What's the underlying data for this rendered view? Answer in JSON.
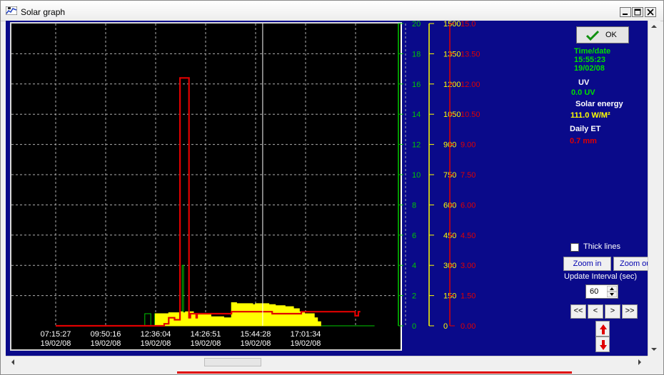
{
  "window": {
    "title": "Solar graph"
  },
  "buttons": {
    "ok": "OK",
    "zoom_in": "Zoom in",
    "zoom_out": "Zoom out"
  },
  "info": {
    "time_label": "Time/date",
    "time": "15:55:23",
    "date": "19/02/08",
    "uv_label": "UV",
    "uv_value": "0.0 UV",
    "solar_label": "Solar energy",
    "solar_value": "111.0 W/M²",
    "et_label": "Daily ET",
    "et_value": "0.7 mm"
  },
  "controls": {
    "thick_lines": "Thick lines",
    "thick_lines_checked": false,
    "update_interval_label": "Update Interval (sec)",
    "update_interval_value": "60",
    "nav_first": "<<",
    "nav_prev": "<",
    "nav_next": ">",
    "nav_last": ">>"
  },
  "colors": {
    "uv": "#00c800",
    "solar": "#ffff00",
    "et": "#e00000",
    "background": "#0a0a8a",
    "plot_bg": "#000000"
  },
  "chart_data": {
    "type": "line",
    "x_ticks": [
      {
        "time": "07:15:27",
        "date": "19/02/08"
      },
      {
        "time": "09:50:16",
        "date": "19/02/08"
      },
      {
        "time": "12:36:04",
        "date": "19/02/08"
      },
      {
        "time": "14:26:51",
        "date": "19/02/08"
      },
      {
        "time": "15:44:28",
        "date": "19/02/08"
      },
      {
        "time": "17:01:34",
        "date": "19/02/08"
      }
    ],
    "cursor_time": "15:55:23",
    "uv_axis": {
      "ylim": [
        0,
        20
      ],
      "ticks": [
        "0",
        "2",
        "4",
        "6",
        "8",
        "10",
        "12",
        "14",
        "16",
        "18",
        "20"
      ]
    },
    "solar_axis": {
      "ylim": [
        0,
        1500
      ],
      "ticks": [
        "0",
        "150",
        "300",
        "450",
        "600",
        "750",
        "900",
        "1050",
        "1200",
        "1350",
        "1500"
      ]
    },
    "et_axis": {
      "ylim": [
        0,
        15
      ],
      "ticks": [
        "0.00",
        "1.50",
        "3.00",
        "4.50",
        "6.00",
        "7.50",
        "9.00",
        "10.50",
        "12.00",
        "13.50",
        "15.0"
      ]
    },
    "grid": true,
    "series": [
      {
        "key": "uv",
        "points": [
          [
            "07:15:27",
            0
          ],
          [
            "12:00:00",
            0
          ],
          [
            "12:00:00",
            0.8
          ],
          [
            "12:20:00",
            0.8
          ],
          [
            "12:20:00",
            0
          ],
          [
            "12:33:00",
            0
          ],
          [
            "12:33:00",
            0.8
          ],
          [
            "12:55:00",
            0.8
          ],
          [
            "12:55:00",
            0
          ],
          [
            "13:05:00",
            0
          ],
          [
            "13:05:00",
            0.8
          ],
          [
            "13:35:00",
            0.8
          ],
          [
            "13:35:00",
            4.0
          ],
          [
            "13:38:00",
            4.0
          ],
          [
            "13:38:00",
            0
          ],
          [
            "14:25:00",
            0
          ],
          [
            "14:25:00",
            0.3
          ],
          [
            "17:20:00",
            0.3
          ],
          [
            "17:20:00",
            0
          ],
          [
            "18:48:00",
            0
          ]
        ]
      },
      {
        "key": "solar",
        "points": [
          [
            "12:35:00",
            0
          ],
          [
            "12:35:00",
            60
          ],
          [
            "13:05:00",
            60
          ],
          [
            "13:05:00",
            65
          ],
          [
            "13:30:00",
            65
          ],
          [
            "13:30:00",
            70
          ],
          [
            "13:36:00",
            70
          ],
          [
            "13:36:00",
            65
          ],
          [
            "13:42:00",
            65
          ],
          [
            "13:42:00",
            70
          ],
          [
            "14:00:00",
            70
          ],
          [
            "14:00:00",
            60
          ],
          [
            "14:35:00",
            60
          ],
          [
            "14:35:00",
            45
          ],
          [
            "14:55:00",
            45
          ],
          [
            "14:55:00",
            40
          ],
          [
            "15:07:00",
            40
          ],
          [
            "15:07:00",
            115
          ],
          [
            "15:15:00",
            115
          ],
          [
            "15:15:00",
            110
          ],
          [
            "15:40:00",
            110
          ],
          [
            "15:40:00",
            105
          ],
          [
            "15:44:00",
            105
          ],
          [
            "15:44:00",
            110
          ],
          [
            "16:05:00",
            110
          ],
          [
            "16:05:00",
            105
          ],
          [
            "16:15:00",
            105
          ],
          [
            "16:15:00",
            100
          ],
          [
            "16:30:00",
            100
          ],
          [
            "16:30:00",
            95
          ],
          [
            "16:43:00",
            95
          ],
          [
            "16:43:00",
            85
          ],
          [
            "16:52:00",
            85
          ],
          [
            "16:52:00",
            70
          ],
          [
            "17:00:00",
            70
          ],
          [
            "17:00:00",
            60
          ],
          [
            "17:15:00",
            60
          ],
          [
            "17:15:00",
            40
          ],
          [
            "17:20:00",
            40
          ],
          [
            "17:20:00",
            20
          ],
          [
            "17:25:00",
            20
          ],
          [
            "17:25:00",
            0
          ]
        ]
      },
      {
        "key": "et",
        "points": [
          [
            "07:15:27",
            0
          ],
          [
            "12:55:00",
            0
          ],
          [
            "12:55:00",
            0.1
          ],
          [
            "13:05:00",
            0.1
          ],
          [
            "13:05:00",
            0.4
          ],
          [
            "13:18:00",
            0.4
          ],
          [
            "13:18:00",
            0.3
          ],
          [
            "13:30:00",
            0.3
          ],
          [
            "13:30:00",
            0.4
          ],
          [
            "13:30:00",
            12.3
          ],
          [
            "13:50:00",
            12.3
          ],
          [
            "13:50:00",
            0.4
          ],
          [
            "13:53:00",
            0.4
          ],
          [
            "13:53:00",
            0.6
          ],
          [
            "14:06:00",
            0.6
          ],
          [
            "14:06:00",
            0.4
          ],
          [
            "14:08:00",
            0.4
          ],
          [
            "14:08:00",
            0.6
          ],
          [
            "15:07:00",
            0.6
          ],
          [
            "15:07:00",
            0.7
          ],
          [
            "16:10:00",
            0.7
          ],
          [
            "16:10:00",
            0.6
          ],
          [
            "16:55:00",
            0.6
          ],
          [
            "16:55:00",
            0.7
          ],
          [
            "18:18:00",
            0.7
          ],
          [
            "18:18:00",
            0.5
          ],
          [
            "18:23:00",
            0.5
          ],
          [
            "18:23:00",
            0.7
          ],
          [
            "18:26:00",
            0.7
          ]
        ]
      }
    ]
  }
}
